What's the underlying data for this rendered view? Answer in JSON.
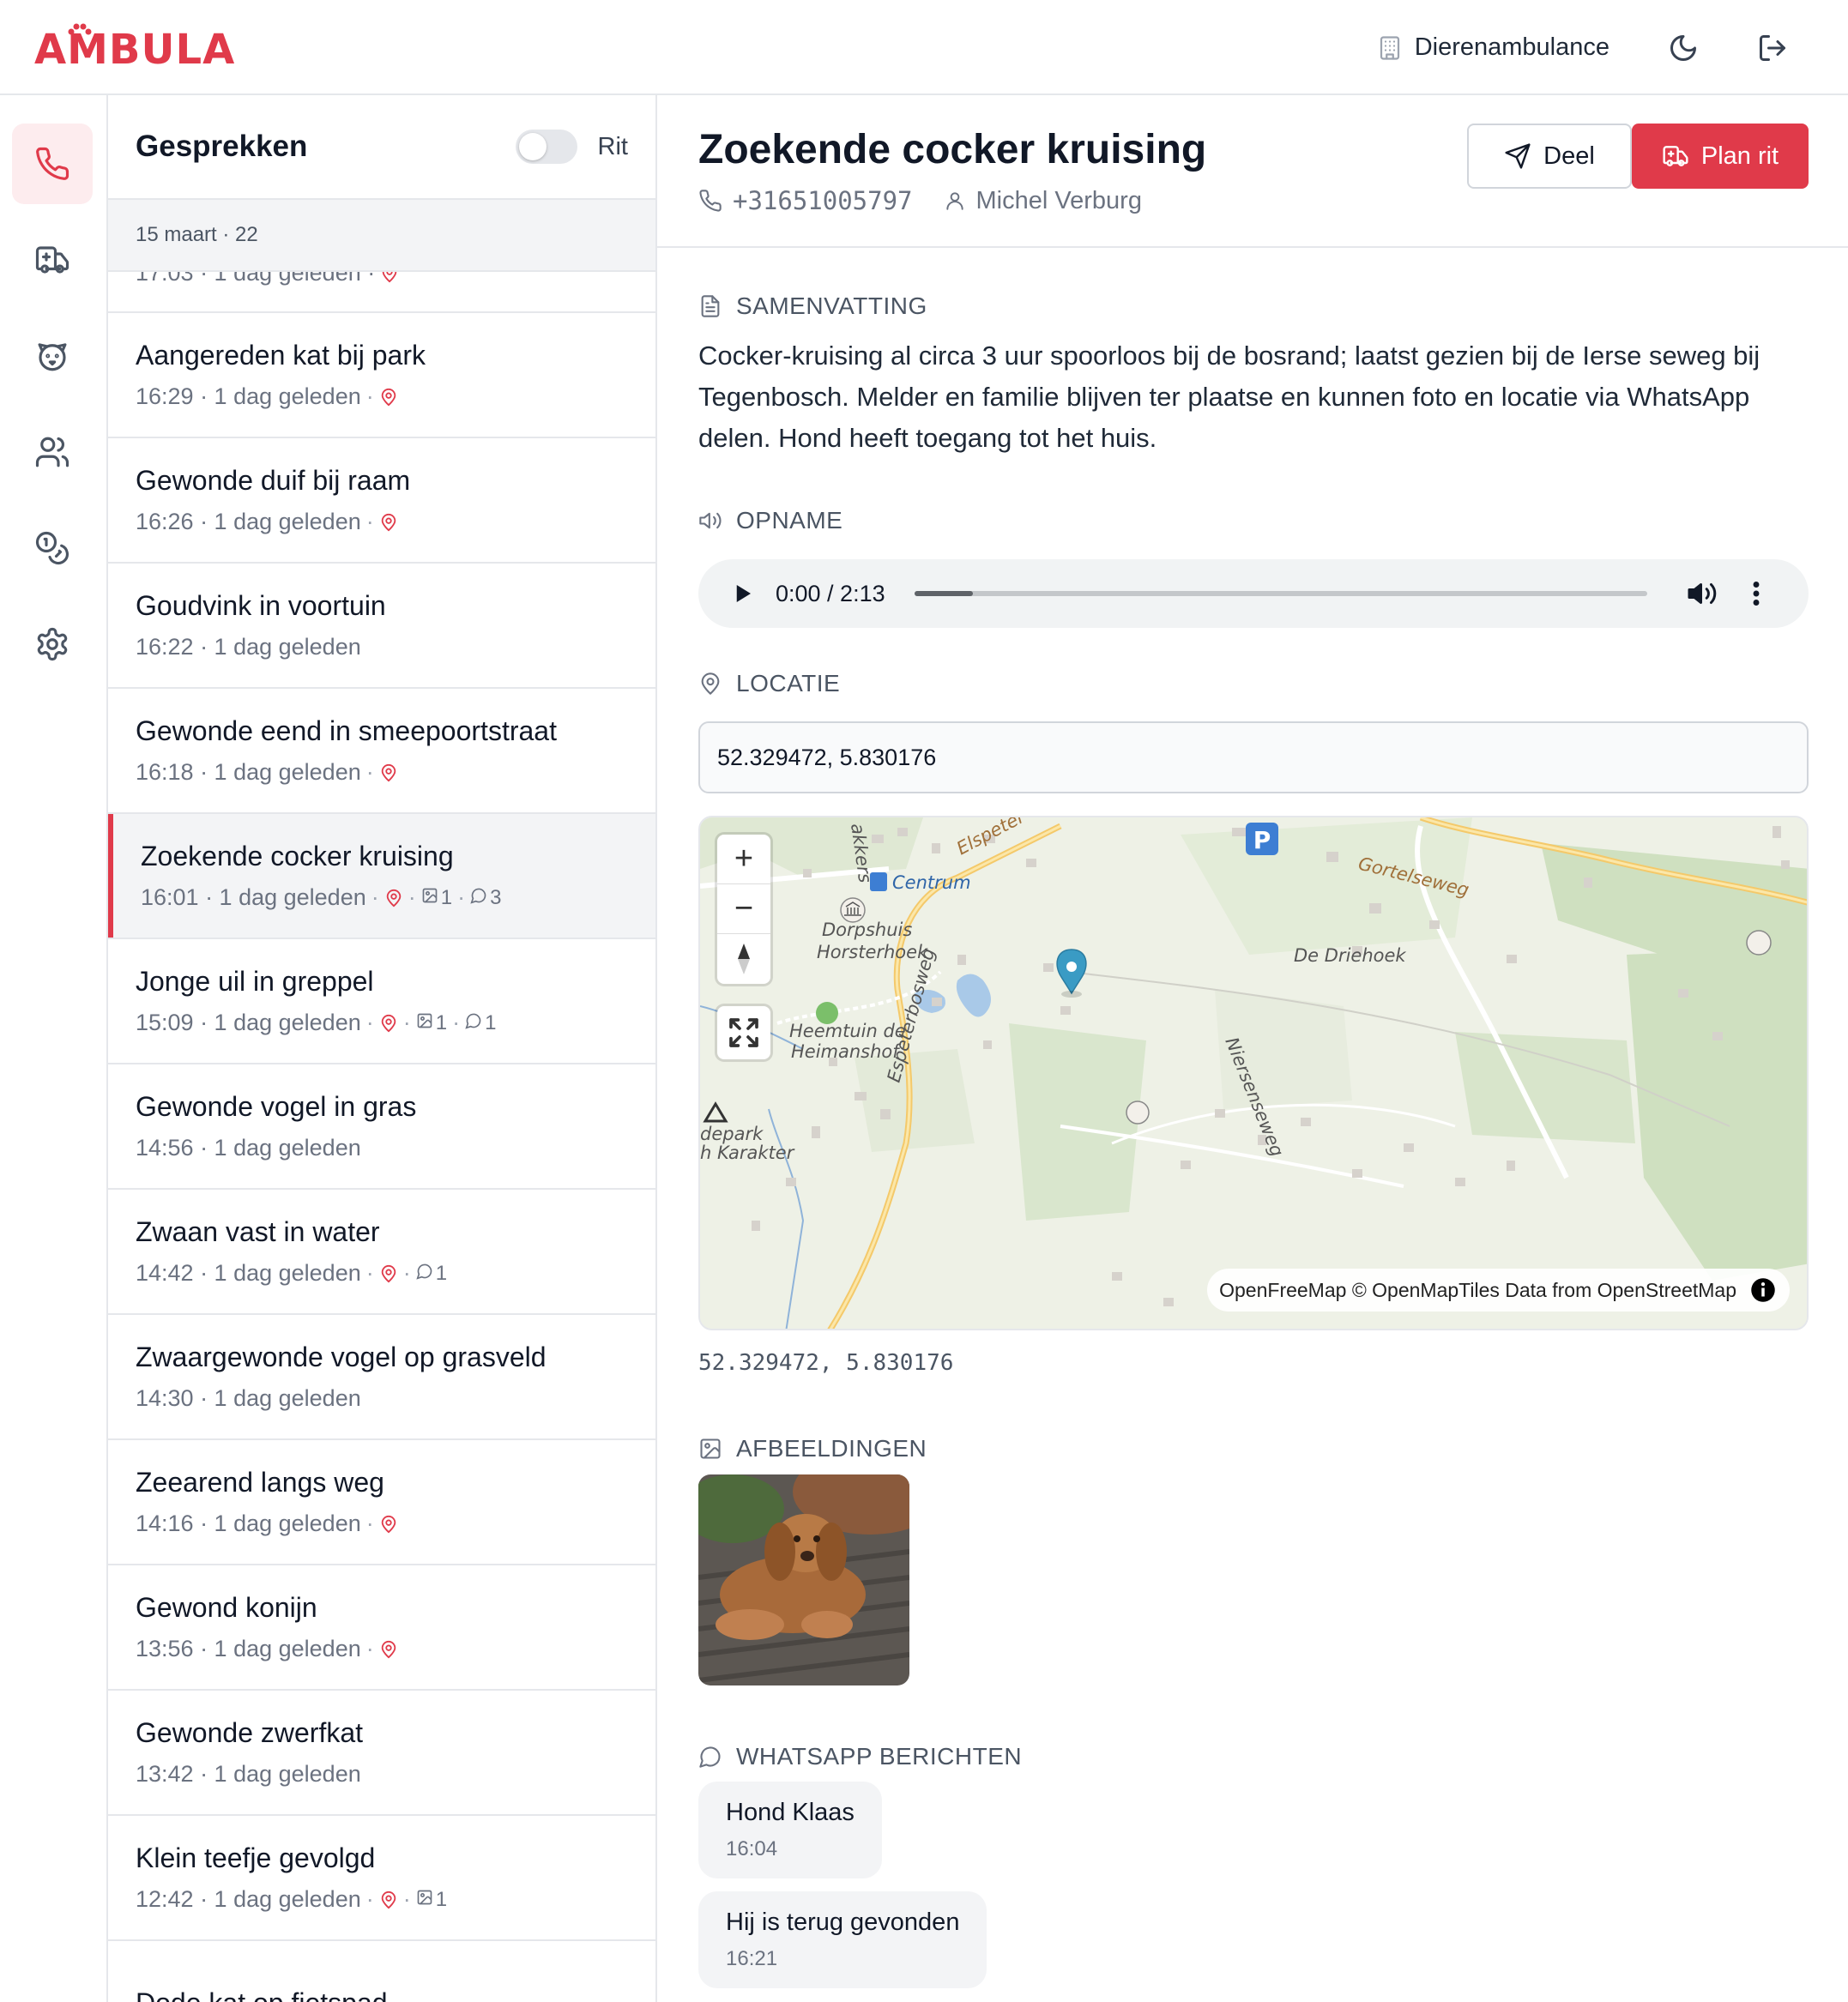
{
  "app": {
    "logo_text": "AMBULA",
    "organization": "Dierenambulance",
    "accent_color": "#e03a4a"
  },
  "rail": {
    "icons": [
      "phone-icon",
      "ambulance-icon",
      "animal-icon",
      "users-icon",
      "coins-icon",
      "gear-icon"
    ]
  },
  "list": {
    "title": "Gesprekken",
    "toggle_label": "Rit",
    "date_header": "15 maart · 22",
    "partial_item_meta": "17:03 · 1 dag geleden ·",
    "items": [
      {
        "title": "Aangereden kat bij park",
        "meta": "16:29 · 1 dag geleden",
        "location": true
      },
      {
        "title": "Gewonde duif bij raam",
        "meta": "16:26 · 1 dag geleden",
        "location": true
      },
      {
        "title": "Goudvink in voortuin",
        "meta": "16:22 · 1 dag geleden",
        "location": false
      },
      {
        "title": "Gewonde eend in smeepoortstraat",
        "meta": "16:18 · 1 dag geleden",
        "location": true
      },
      {
        "title": "Zoekende cocker kruising",
        "meta": "16:01 · 1 dag geleden",
        "location": true,
        "images": "1",
        "messages": "3",
        "selected": true
      },
      {
        "title": "Jonge uil in greppel",
        "meta": "15:09 · 1 dag geleden",
        "location": true,
        "images": "1",
        "messages": "1"
      },
      {
        "title": "Gewonde vogel in gras",
        "meta": "14:56 · 1 dag geleden",
        "location": false
      },
      {
        "title": "Zwaan vast in water",
        "meta": "14:42 · 1 dag geleden",
        "location": true,
        "messages": "1"
      },
      {
        "title": "Zwaargewonde vogel op grasveld",
        "meta": "14:30 · 1 dag geleden",
        "location": false
      },
      {
        "title": "Zeearend langs weg",
        "meta": "14:16 · 1 dag geleden",
        "location": true
      },
      {
        "title": "Gewond konijn",
        "meta": "13:56 · 1 dag geleden",
        "location": true
      },
      {
        "title": "Gewonde zwerfkat",
        "meta": "13:42 · 1 dag geleden",
        "location": false
      },
      {
        "title": "Klein teefje gevolgd",
        "meta": "12:42 · 1 dag geleden",
        "location": true,
        "images": "1"
      },
      {
        "title": "Dode kat op fietspad",
        "meta": "",
        "location": false
      }
    ]
  },
  "detail": {
    "title": "Zoekende cocker kruising",
    "phone": "+31651005797",
    "caller": "Michel Verburg",
    "share_label": "Deel",
    "plan_label": "Plan rit",
    "summary_label": "SAMENVATTING",
    "summary": "Cocker-kruising al circa 3 uur spoorloos bij de bosrand; laatst gezien bij de Ierse seweg bij Tegenbosch. Melder en familie blijven ter plaatse en kunnen foto en locatie via WhatsApp delen. Hond heeft toegang tot het huis.",
    "recording_label": "OPNAME",
    "audio_time": "0:00 / 2:13",
    "audio_progress": 0.08,
    "location_label": "LOCATIE",
    "location_value": "52.329472, 5.830176",
    "coords_text": "52.329472, 5.830176",
    "images_label": "AFBEELDINGEN",
    "whatsapp_label": "WHATSAPP BERICHTEN",
    "messages": [
      {
        "text": "Hond Klaas",
        "time": "16:04"
      },
      {
        "text": "Hij is terug gevonden",
        "time": "16:21"
      }
    ]
  },
  "map": {
    "labels": {
      "centrum": "Centrum",
      "dorpshuis": "Dorpshuis",
      "horsterhoek": "Horsterhoek",
      "heemtuin1": "Heemtuin de",
      "heemtuin2": "Heimanshof",
      "espeterbosweg": "Espeterbosweg",
      "elspeter": "Elspeter",
      "akkers": "akkers",
      "gortelseweg": "Gortelseweg",
      "niersenseweg": "Niersenseweg",
      "driehoek": "De Driehoek",
      "depark": "depark",
      "karakter": "h Karakter"
    },
    "attribution": "OpenFreeMap © OpenMapTiles Data from OpenStreetMap",
    "zoom_in": "+",
    "zoom_out": "−"
  }
}
